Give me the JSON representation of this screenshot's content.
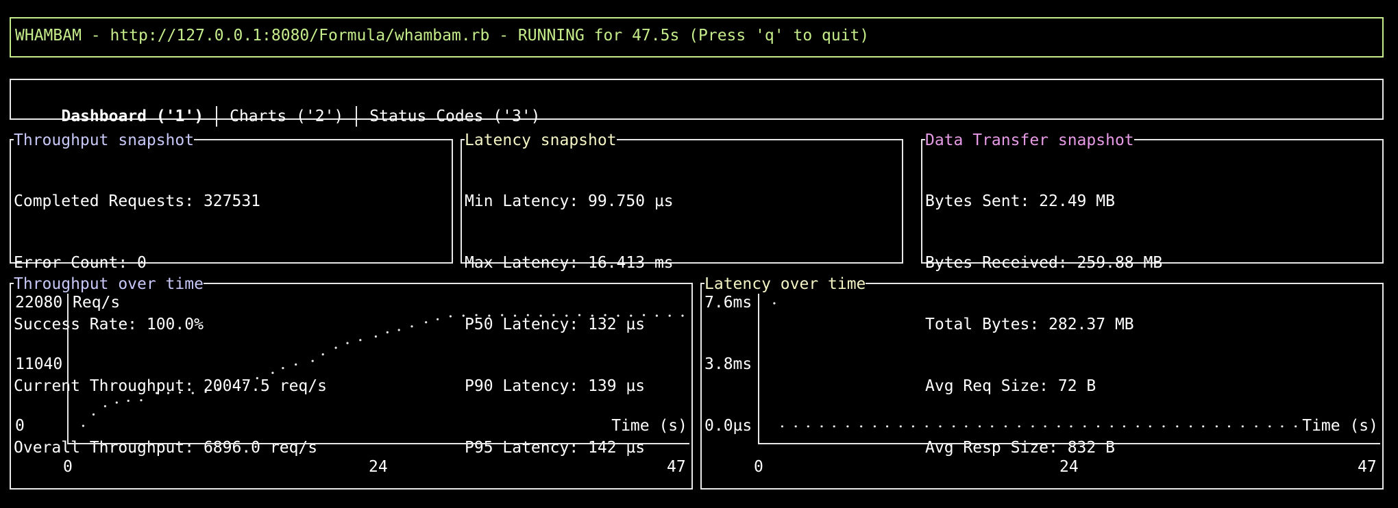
{
  "app": {
    "title_line": "WHAMBAM - http://127.0.0.1:8080/Formula/whambam.rb - RUNNING for 47.5s (Press 'q' to quit)"
  },
  "tabs": [
    {
      "label": "Dashboard ('1')",
      "active": true
    },
    {
      "label": "Charts ('2')",
      "active": false
    },
    {
      "label": "Status Codes ('3')",
      "active": false
    }
  ],
  "throughput": {
    "title": "Throughput snapshot",
    "title_color": "#c8c8f8",
    "lines": [
      "Completed Requests: 327531",
      "Error Count: 0",
      "Success Rate: 100.0%",
      "Current Throughput: 20047.5 req/s",
      "Overall Throughput: 6896.0 req/s"
    ]
  },
  "latency": {
    "title": "Latency snapshot",
    "title_color": "#f3f3c4",
    "lines": [
      "Min Latency: 99.750 µs",
      "Max Latency: 16.413 ms",
      "P50 Latency: 132 µs",
      "P90 Latency: 139 µs",
      "P95 Latency: 142 µs"
    ]
  },
  "transfer": {
    "title": "Data Transfer snapshot",
    "title_color": "#e79ae6",
    "lines": [
      "Bytes Sent: 22.49 MB",
      "Bytes Received: 259.88 MB",
      "Total Bytes: 282.37 MB",
      "Avg Req Size: 72 B",
      "Avg Resp Size: 832 B"
    ]
  },
  "chart_data": [
    {
      "type": "scatter",
      "title": "Throughput over time",
      "title_color": "#c8c8f8",
      "ylabel": "Req/s",
      "xlabel": "Time (s)",
      "yticks": [
        "22080",
        "11040",
        "0"
      ],
      "xticks": [
        "0",
        "24",
        "47"
      ],
      "xlim": [
        0,
        47
      ],
      "ylim": [
        0,
        22080
      ],
      "x": [
        0.5,
        1.3,
        2.2,
        3.1,
        4,
        5,
        6.2,
        7.1,
        8,
        9,
        10,
        11,
        12.2,
        13,
        14,
        15.2,
        16,
        17,
        18.3,
        19.1,
        20.1,
        21,
        22,
        23.2,
        24.1,
        25,
        26,
        27.1,
        28,
        29,
        30,
        31,
        32,
        33,
        34,
        35,
        36,
        37,
        38,
        39,
        40,
        41,
        42,
        43,
        44,
        45,
        46,
        47
      ],
      "y": [
        1500,
        3400,
        4800,
        5400,
        5700,
        5800,
        7000,
        7000,
        7100,
        7000,
        7200,
        7700,
        8300,
        8700,
        9500,
        10400,
        11200,
        11800,
        12400,
        13500,
        14600,
        15400,
        15900,
        16500,
        17200,
        17600,
        18200,
        18900,
        19400,
        19900,
        20000,
        20100,
        20000,
        20100,
        20000,
        20100,
        20000,
        20100,
        20000,
        20100,
        20000,
        20100,
        20000,
        20000,
        20100,
        20000,
        20000,
        20000
      ]
    },
    {
      "type": "scatter",
      "title": "Latency over time",
      "title_color": "#f3f3c4",
      "ylabel": "",
      "xlabel": "Time (s)",
      "yticks": [
        "7.6ms",
        "3.8ms",
        "0.0µs"
      ],
      "xticks": [
        "0",
        "24",
        "47"
      ],
      "xlim": [
        0,
        47
      ],
      "ylim": [
        0,
        7.6
      ],
      "x": [
        0.6,
        1.3,
        2.5,
        3.6,
        4.8,
        5.9,
        7.1,
        8.3,
        9.5,
        10.6,
        11.8,
        12.9,
        14.1,
        15.3,
        16.5,
        17.6,
        18.8,
        19.9,
        21.1,
        22.3,
        23.5,
        24.6,
        25.8,
        26.9,
        28.1,
        29.3,
        30.5,
        31.6,
        32.8,
        33.9,
        35.1,
        36.3,
        37.5,
        38.6,
        39.8,
        40.9,
        42.1,
        43.3,
        44.5,
        45.6,
        46.8
      ],
      "y": [
        7.6,
        0.01,
        0.01,
        0.01,
        0.01,
        0.01,
        0.01,
        0.01,
        0.01,
        0.01,
        0.01,
        0.01,
        0.01,
        0.01,
        0.01,
        0.01,
        0.01,
        0.01,
        0.01,
        0.01,
        0.01,
        0.01,
        0.01,
        0.01,
        0.01,
        0.01,
        0.01,
        0.01,
        0.01,
        0.01,
        0.01,
        0.01,
        0.01,
        0.01,
        0.01,
        0.01,
        0.01,
        0.01,
        0.01,
        0.01,
        0.01
      ]
    }
  ]
}
